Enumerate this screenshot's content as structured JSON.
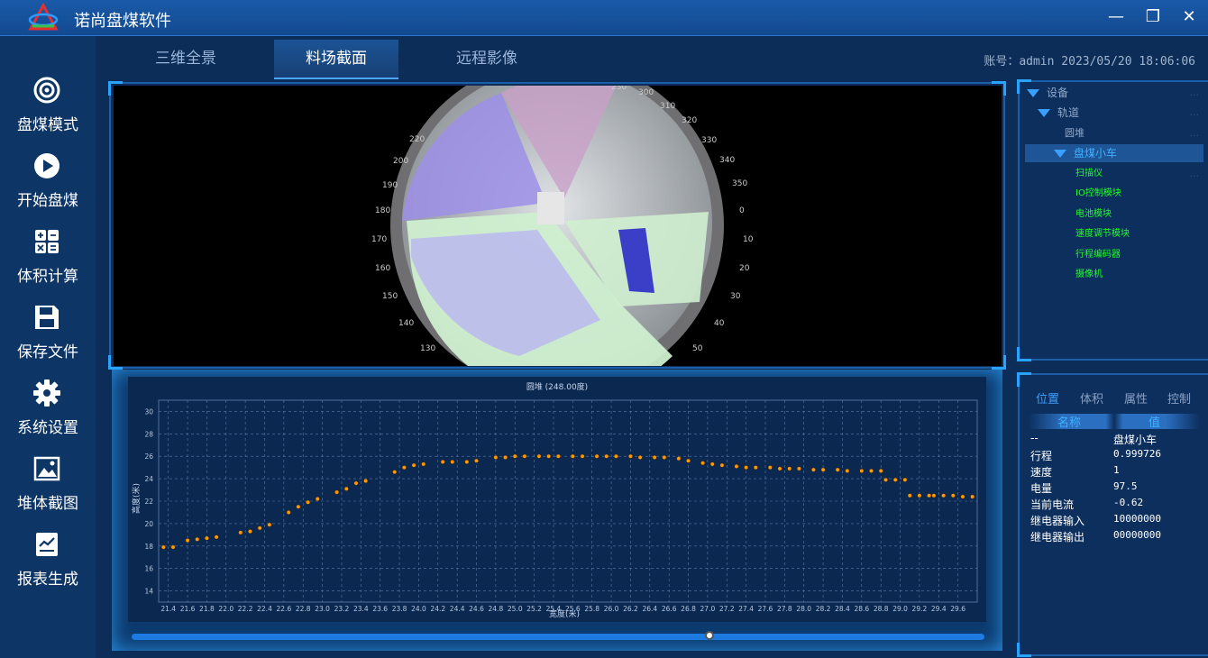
{
  "app": {
    "title": "诺尚盘煤软件"
  },
  "window": {
    "minimize": "—",
    "maximize": "❐",
    "close": "✕"
  },
  "sidebar": {
    "items": [
      {
        "label": "盘煤模式",
        "icon": "target-icon"
      },
      {
        "label": "开始盘煤",
        "icon": "play-icon"
      },
      {
        "label": "体积计算",
        "icon": "calculator-icon"
      },
      {
        "label": "保存文件",
        "icon": "save-icon"
      },
      {
        "label": "系统设置",
        "icon": "gear-icon"
      },
      {
        "label": "堆体截图",
        "icon": "image-icon"
      },
      {
        "label": "报表生成",
        "icon": "report-icon"
      }
    ]
  },
  "tabs": [
    {
      "label": "三维全景"
    },
    {
      "label": "料场截面",
      "active": true
    },
    {
      "label": "远程影像"
    }
  ],
  "header": {
    "account": "账号：admin  2023/05/20 18:06:06"
  },
  "viewer": {
    "compass_labels": [
      "300",
      "310",
      "320",
      "330",
      "340",
      "350",
      "0",
      "10",
      "20",
      "30",
      "40",
      "50",
      "230",
      "220",
      "200",
      "190",
      "180",
      "170",
      "160",
      "150",
      "140",
      "130"
    ]
  },
  "chart_data": {
    "type": "scatter",
    "title": "圆堆 (248.00度)",
    "xlabel": "宽度(米)",
    "ylabel": "高度(米)",
    "xlim": [
      21.3,
      29.8
    ],
    "ylim": [
      13,
      31
    ],
    "xticks": [
      "21.4",
      "21.6",
      "21.8",
      "22.0",
      "22.2",
      "22.4",
      "22.6",
      "22.8",
      "23.0",
      "23.2",
      "23.4",
      "23.6",
      "23.8",
      "24.0",
      "24.2",
      "24.4",
      "24.6",
      "24.8",
      "25.0",
      "25.2",
      "25.4",
      "25.6",
      "25.8",
      "26.0",
      "26.2",
      "26.4",
      "26.6",
      "26.8",
      "27.0",
      "27.2",
      "27.4",
      "27.6",
      "27.8",
      "28.0",
      "28.2",
      "28.4",
      "28.6",
      "28.8",
      "29.0",
      "29.2",
      "29.4",
      "29.6"
    ],
    "yticks": [
      "14",
      "16",
      "18",
      "20",
      "22",
      "24",
      "26",
      "28",
      "30"
    ],
    "grid": true,
    "points": [
      [
        21.35,
        17.9
      ],
      [
        21.45,
        17.9
      ],
      [
        21.6,
        18.5
      ],
      [
        21.7,
        18.6
      ],
      [
        21.8,
        18.7
      ],
      [
        21.9,
        18.8
      ],
      [
        22.15,
        19.2
      ],
      [
        22.25,
        19.3
      ],
      [
        22.35,
        19.6
      ],
      [
        22.45,
        19.9
      ],
      [
        22.65,
        21.0
      ],
      [
        22.75,
        21.5
      ],
      [
        22.85,
        21.9
      ],
      [
        22.95,
        22.2
      ],
      [
        23.15,
        22.8
      ],
      [
        23.25,
        23.1
      ],
      [
        23.35,
        23.6
      ],
      [
        23.45,
        23.8
      ],
      [
        23.75,
        24.6
      ],
      [
        23.85,
        25.0
      ],
      [
        23.95,
        25.2
      ],
      [
        24.05,
        25.3
      ],
      [
        24.25,
        25.5
      ],
      [
        24.35,
        25.5
      ],
      [
        24.5,
        25.5
      ],
      [
        24.6,
        25.6
      ],
      [
        24.8,
        25.9
      ],
      [
        24.9,
        25.9
      ],
      [
        25.0,
        26.0
      ],
      [
        25.1,
        26.0
      ],
      [
        25.25,
        26.0
      ],
      [
        25.35,
        26.0
      ],
      [
        25.45,
        26.0
      ],
      [
        25.6,
        26.0
      ],
      [
        25.7,
        26.0
      ],
      [
        25.85,
        26.0
      ],
      [
        25.95,
        26.0
      ],
      [
        26.05,
        26.0
      ],
      [
        26.2,
        26.0
      ],
      [
        26.3,
        25.9
      ],
      [
        26.45,
        25.9
      ],
      [
        26.55,
        25.9
      ],
      [
        26.7,
        25.8
      ],
      [
        26.8,
        25.6
      ],
      [
        26.95,
        25.4
      ],
      [
        27.05,
        25.3
      ],
      [
        27.15,
        25.2
      ],
      [
        27.3,
        25.1
      ],
      [
        27.4,
        25.0
      ],
      [
        27.5,
        25.0
      ],
      [
        27.65,
        25.0
      ],
      [
        27.75,
        24.9
      ],
      [
        27.85,
        24.9
      ],
      [
        27.95,
        24.9
      ],
      [
        28.1,
        24.8
      ],
      [
        28.2,
        24.8
      ],
      [
        28.35,
        24.8
      ],
      [
        28.45,
        24.7
      ],
      [
        28.6,
        24.7
      ],
      [
        28.7,
        24.7
      ],
      [
        28.8,
        24.7
      ],
      [
        28.85,
        23.9
      ],
      [
        28.95,
        23.9
      ],
      [
        29.05,
        23.9
      ],
      [
        29.1,
        22.5
      ],
      [
        29.2,
        22.5
      ],
      [
        29.3,
        22.5
      ],
      [
        29.35,
        22.5
      ],
      [
        29.45,
        22.5
      ],
      [
        29.55,
        22.5
      ],
      [
        29.65,
        22.4
      ],
      [
        29.75,
        22.4
      ]
    ]
  },
  "tree": {
    "root": "设备",
    "track": "轨道",
    "pile": "圆堆",
    "car": "盘煤小车",
    "modules": [
      "扫描仪",
      "IO控制模块",
      "电池模块",
      "速度调节模块",
      "行程编码器",
      "摄像机"
    ],
    "dots": "..."
  },
  "props": {
    "tabs": [
      "位置",
      "体积",
      "属性",
      "控制"
    ],
    "head_name": "名称",
    "head_value": "值",
    "rows": [
      {
        "name": "--",
        "value": "盘煤小车"
      },
      {
        "name": "行程",
        "value": "0.999726"
      },
      {
        "name": "速度",
        "value": "1"
      },
      {
        "name": "电量",
        "value": "97.5"
      },
      {
        "name": "当前电流",
        "value": "-0.62"
      },
      {
        "name": "继电器输入",
        "value": "10000000"
      },
      {
        "name": "继电器输出",
        "value": "00000000"
      }
    ]
  },
  "colors": {
    "accent": "#2aa3ff",
    "point": "#ff9900",
    "module_text": "#22ff22"
  }
}
